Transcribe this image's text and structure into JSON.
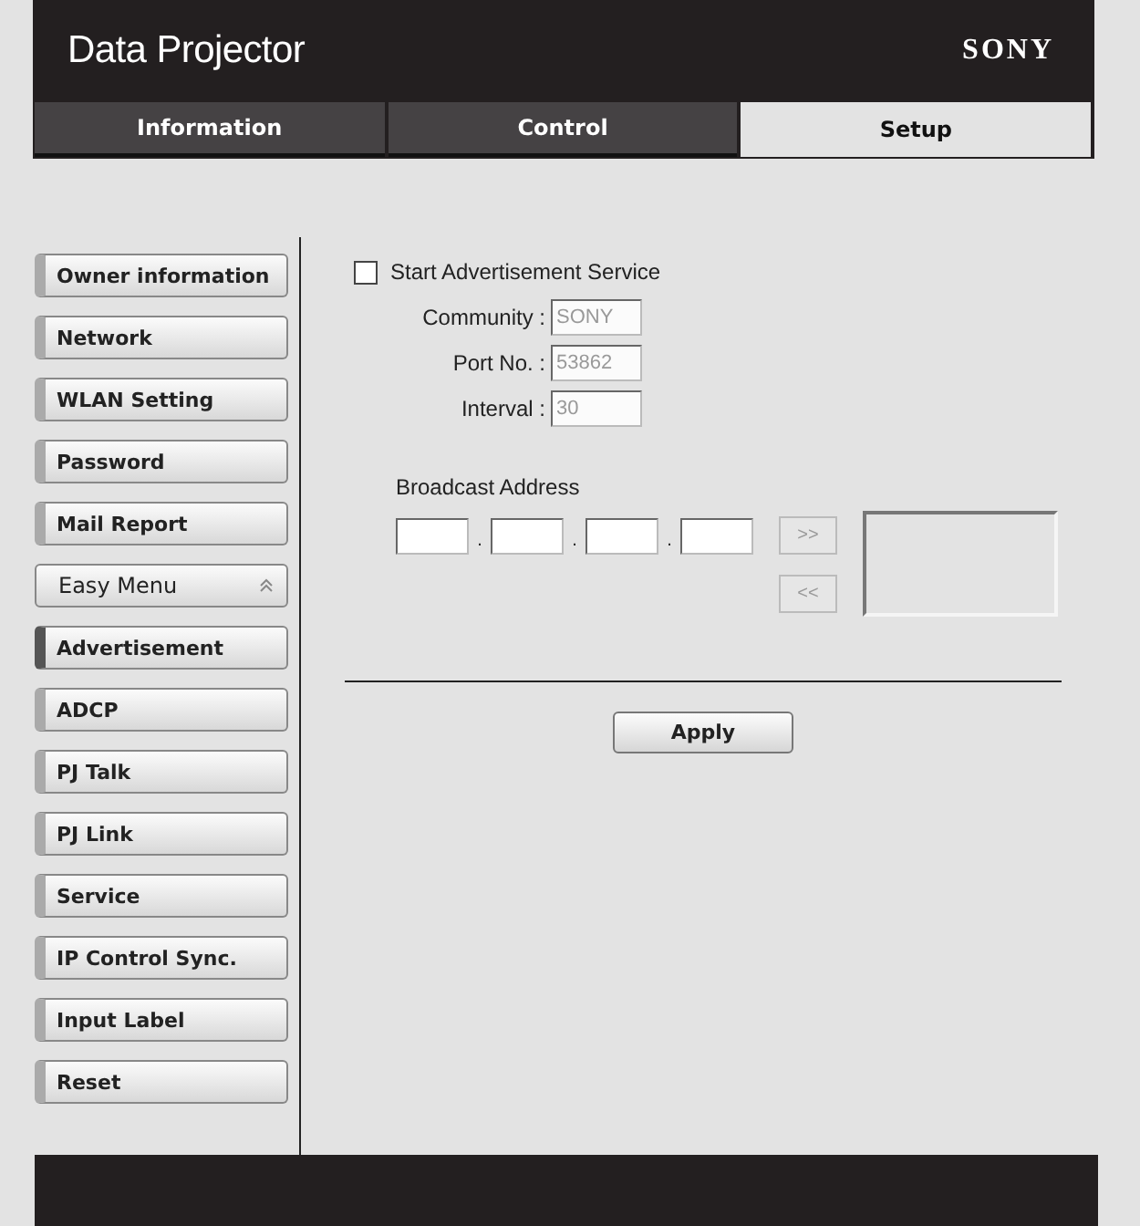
{
  "header": {
    "title": "Data Projector",
    "brand": "SONY"
  },
  "tabs": [
    {
      "label": "Information",
      "selected": false
    },
    {
      "label": "Control",
      "selected": false
    },
    {
      "label": "Setup",
      "selected": true
    }
  ],
  "sidebar": {
    "items": [
      {
        "label": "Owner information",
        "kind": "item",
        "selected": false
      },
      {
        "label": "Network",
        "kind": "item",
        "selected": false
      },
      {
        "label": "WLAN Setting",
        "kind": "item",
        "selected": false
      },
      {
        "label": "Password",
        "kind": "item",
        "selected": false
      },
      {
        "label": "Mail Report",
        "kind": "item",
        "selected": false
      },
      {
        "label": "Easy Menu",
        "kind": "group",
        "expanded": true
      },
      {
        "label": "Advertisement",
        "kind": "item",
        "selected": true
      },
      {
        "label": "ADCP",
        "kind": "item",
        "selected": false
      },
      {
        "label": "PJ Talk",
        "kind": "item",
        "selected": false
      },
      {
        "label": "PJ Link",
        "kind": "item",
        "selected": false
      },
      {
        "label": "Service",
        "kind": "item",
        "selected": false
      },
      {
        "label": "IP Control Sync.",
        "kind": "item",
        "selected": false
      },
      {
        "label": "Input Label",
        "kind": "item",
        "selected": false
      },
      {
        "label": "Reset",
        "kind": "item",
        "selected": false
      }
    ]
  },
  "form": {
    "service": {
      "label": "Start Advertisement Service",
      "checked": false
    },
    "fields": [
      {
        "label": "Community :",
        "value": "SONY",
        "disabled": true
      },
      {
        "label": "Port No. :",
        "value": "53862",
        "disabled": true
      },
      {
        "label": "Interval :",
        "value": "30",
        "disabled": true
      }
    ],
    "broadcast": {
      "label": "Broadcast Address",
      "octets": [
        {
          "disabled": false,
          "separator": "."
        },
        {
          "disabled": false,
          "separator": "."
        },
        {
          "disabled": false,
          "separator": "."
        },
        {
          "disabled": false
        }
      ],
      "add_button": ">>",
      "remove_button": "<<"
    },
    "apply_button": "Apply"
  }
}
